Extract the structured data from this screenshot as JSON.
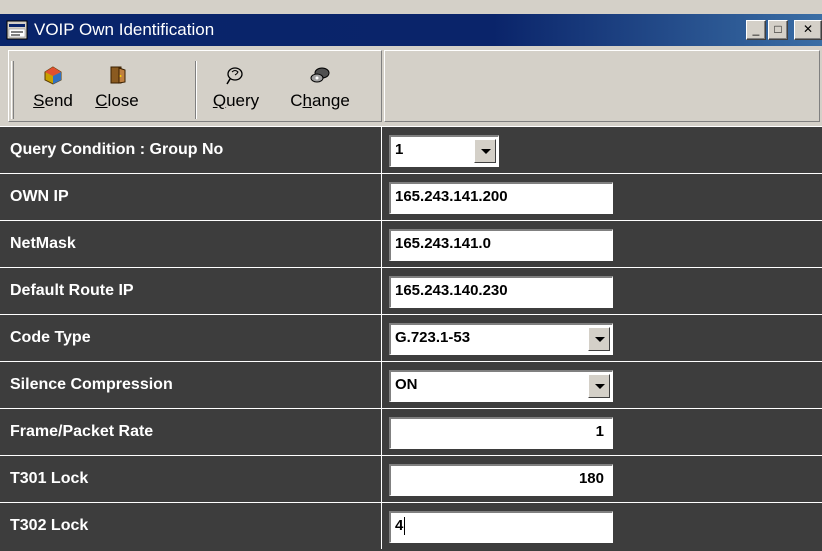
{
  "window": {
    "title": "VOIP Own Identification",
    "minimize_label": "_",
    "maximize_label": "□",
    "close_label": "✕"
  },
  "toolbar": {
    "send": {
      "label_underlined": "S",
      "label_rest": "end",
      "icon": "send-icon"
    },
    "close": {
      "label_underlined": "C",
      "label_rest": "lose",
      "icon": "door-icon"
    },
    "query": {
      "label_underlined": "Q",
      "label_rest": "uery",
      "icon": "query-icon"
    },
    "change": {
      "label_pre": "C",
      "label_underlined": "h",
      "label_rest": "ange",
      "icon": "change-icon"
    }
  },
  "form": {
    "query_condition": {
      "label": "Query Condition : Group No",
      "value": "1"
    },
    "own_ip": {
      "label": "OWN IP",
      "value": "165.243.141.200"
    },
    "netmask": {
      "label": "NetMask",
      "value": "165.243.141.0"
    },
    "default_route": {
      "label": "Default Route IP",
      "value": "165.243.140.230"
    },
    "code_type": {
      "label": "Code Type",
      "value": "G.723.1-53"
    },
    "silence": {
      "label": "Silence Compression",
      "value": "ON"
    },
    "frame_rate": {
      "label": "Frame/Packet Rate",
      "value": "1"
    },
    "t301": {
      "label": "T301 Lock",
      "value": "180"
    },
    "t302": {
      "label": "T302 Lock",
      "value": "4"
    }
  }
}
